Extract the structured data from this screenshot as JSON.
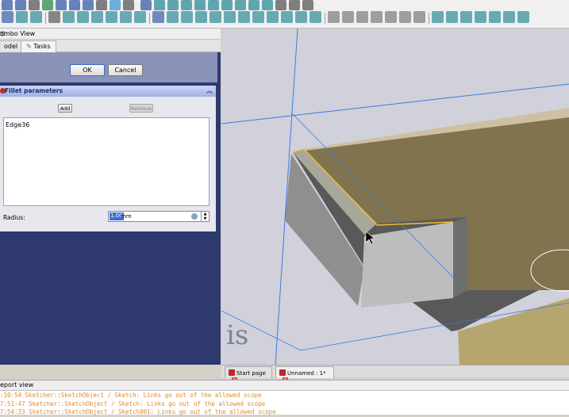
{
  "toolbar": {
    "row1_colors": [
      "#3a5ea8",
      "#3a5ea8",
      "#5a5a5a",
      "#2d8c4a",
      "#3a5ea8",
      "#3a5ea8",
      "#3a5ea8",
      "#5a5a5a",
      "#3a9ad6",
      "#5a5a5a",
      "#3a5ea8",
      "#2d8c9a",
      "#2d8c9a",
      "#2d8c9a",
      "#2d8c9a",
      "#2d8c9a",
      "#2d8c9a",
      "#2d8c9a",
      "#2d8c9a",
      "#2d8c9a",
      "#5a5a5a",
      "#5a5a5a",
      "#5a5a5a"
    ],
    "row2_colors": [
      "#3a5ea8",
      "#2d8c9a",
      "#2d8c9a",
      "#5a5a5a",
      "#2d8c9a",
      "#2d8c9a",
      "#2d8c9a",
      "#2d8c9a",
      "#2d8c9a",
      "#2d8c9a",
      "#3a5ea8",
      "#2d8c9a",
      "#2d8c9a",
      "#2d8c9a",
      "#2d8c9a",
      "#2d8c9a",
      "#2d8c9a",
      "#2d8c9a",
      "#2d8c9a",
      "#2d8c9a",
      "#2d8c9a",
      "#2d8c9a",
      "#7a7a7a",
      "#7a7a7a",
      "#7a7a7a",
      "#7a7a7a",
      "#7a7a7a",
      "#7a7a7a",
      "#7a7a7a",
      "#2d8c9a",
      "#2d8c9a",
      "#2d8c9a",
      "#2d8c9a",
      "#2d8c9a",
      "#2d8c9a",
      "#2d8c9a"
    ]
  },
  "combo": {
    "title": "ombo View",
    "tabs": [
      "odel",
      "Tasks"
    ]
  },
  "task": {
    "ok_label": "OK",
    "cancel_label": "Cancel",
    "panel_title": "Fillet parameters",
    "add_label": "Add",
    "remove_label": "Remove",
    "edges": [
      "Edge36"
    ],
    "radius_label": "Radius:",
    "radius_value": "1.00",
    "radius_unit": "mm"
  },
  "viewport": {
    "watermark": "is",
    "colors": {
      "background": "#d1d1db",
      "axis": "#3a7de0",
      "solid_light": "#c9c9c9",
      "solid_dark": "#6a6a6a",
      "top_face": "#5a5a5a",
      "highlight": "#d8b24a"
    },
    "tabs": [
      {
        "label": "Start page",
        "close": "×"
      },
      {
        "label": "Unnamed : 1*",
        "close": "×"
      }
    ]
  },
  "report": {
    "title": "eport view",
    "lines": [
      ":10:54  Sketcher::SketchObject / Sketch: Links go out of the allowed scope",
      "7:51:47  Sketcher::SketchObject / Sketch: Links go out of the allowed scope",
      "7:54:33  Sketcher::SketchObject / Sketch001: Links go out of the allowed scope"
    ]
  }
}
